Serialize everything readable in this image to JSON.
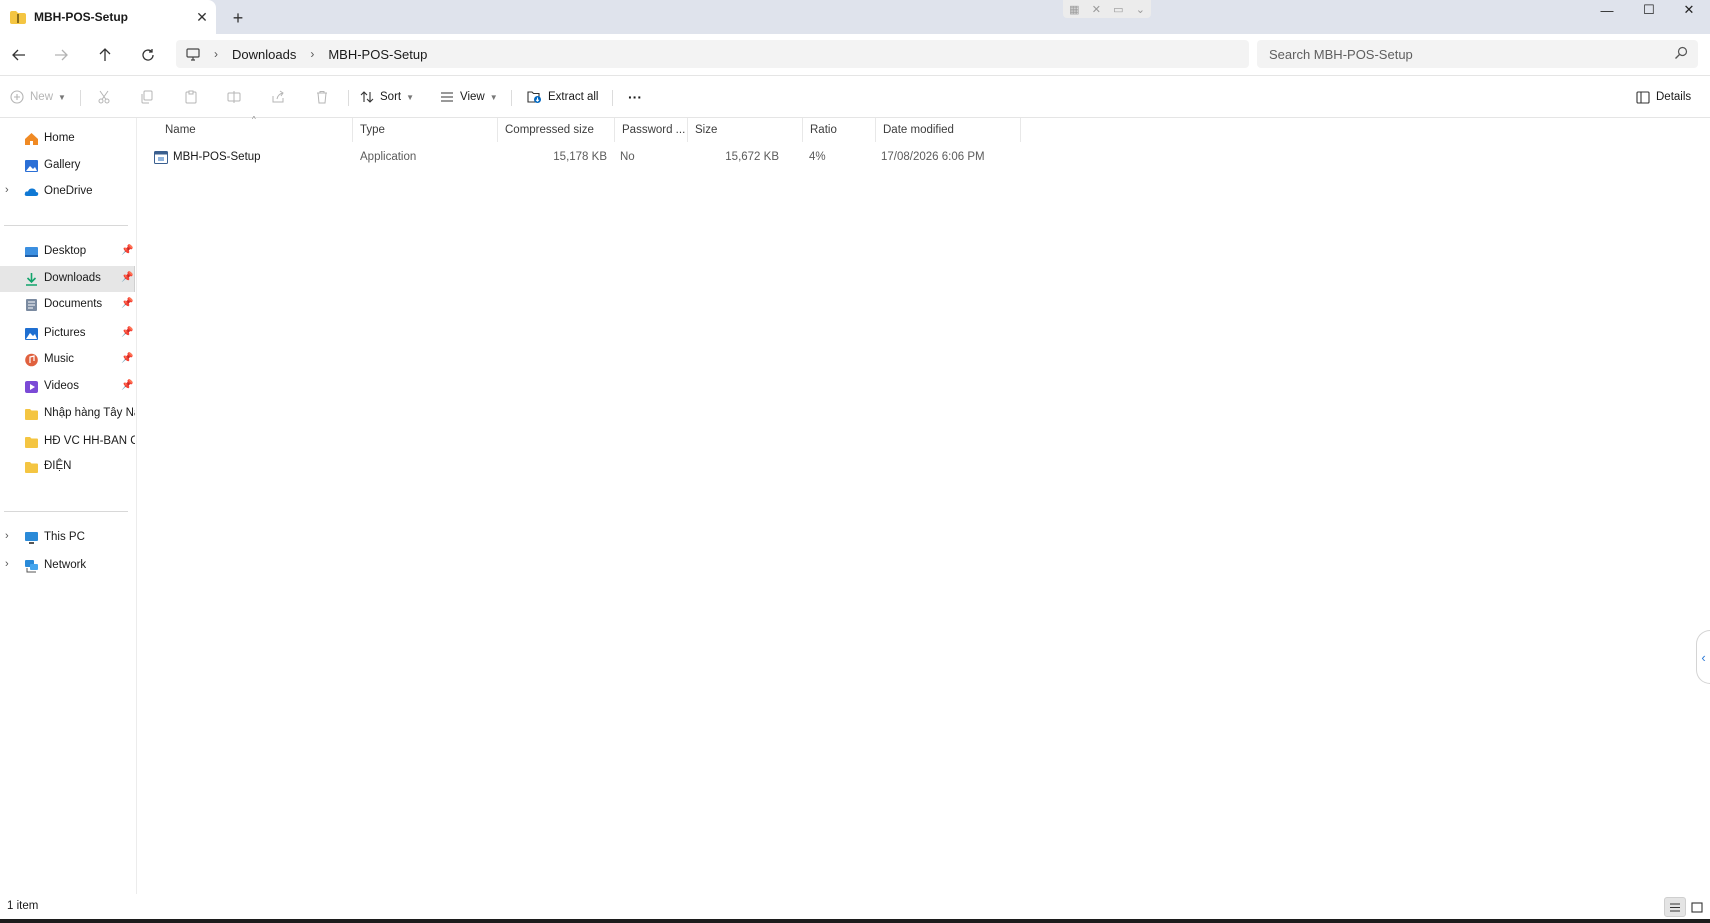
{
  "window": {
    "tab_title": "MBH-POS-Setup",
    "tab_close": "✕",
    "new_tab": "+",
    "minimize": "—",
    "maximize": "☐",
    "close": "✕"
  },
  "address": {
    "root_icon": "monitor-icon",
    "crumbs": [
      "Downloads",
      "MBH-POS-Setup"
    ],
    "separator": "›",
    "search_placeholder": "Search MBH-POS-Setup"
  },
  "toolbar": {
    "new_label": "New",
    "sort_label": "Sort",
    "view_label": "View",
    "extract_label": "Extract all",
    "more_label": "···",
    "details_label": "Details"
  },
  "sidebar": {
    "quick": [
      {
        "label": "Home",
        "icon": "home-icon"
      },
      {
        "label": "Gallery",
        "icon": "gallery-icon"
      },
      {
        "label": "OneDrive",
        "icon": "cloud-icon"
      }
    ],
    "pinned": [
      {
        "label": "Desktop",
        "icon": "desktop-icon"
      },
      {
        "label": "Downloads",
        "icon": "download-icon",
        "selected": true
      },
      {
        "label": "Documents",
        "icon": "documents-icon"
      },
      {
        "label": "Pictures",
        "icon": "pictures-icon"
      },
      {
        "label": "Music",
        "icon": "music-icon"
      },
      {
        "label": "Videos",
        "icon": "videos-icon"
      },
      {
        "label": "Nhập hàng Tây Nam",
        "icon": "folder-icon"
      },
      {
        "label": "HĐ VC HH-BAN CHẤT",
        "icon": "folder-icon"
      },
      {
        "label": "ĐIỆN",
        "icon": "folder-icon"
      }
    ],
    "devices": [
      {
        "label": "This PC",
        "icon": "pc-icon"
      },
      {
        "label": "Network",
        "icon": "network-icon"
      }
    ]
  },
  "columns": [
    "Name",
    "Type",
    "Compressed size",
    "Password ...",
    "Size",
    "Ratio",
    "Date modified"
  ],
  "files": [
    {
      "name": "MBH-POS-Setup",
      "type": "Application",
      "compressed_size": "15,178 KB",
      "password": "No",
      "size": "15,672 KB",
      "ratio": "4%",
      "date_modified": "17/08/2026 6:06 PM"
    }
  ],
  "status": {
    "item_count": "1 item"
  },
  "colors": {
    "accent": "#0067c0",
    "folder": "#f4c542",
    "titlebar_bg": "#dfe3ec"
  }
}
